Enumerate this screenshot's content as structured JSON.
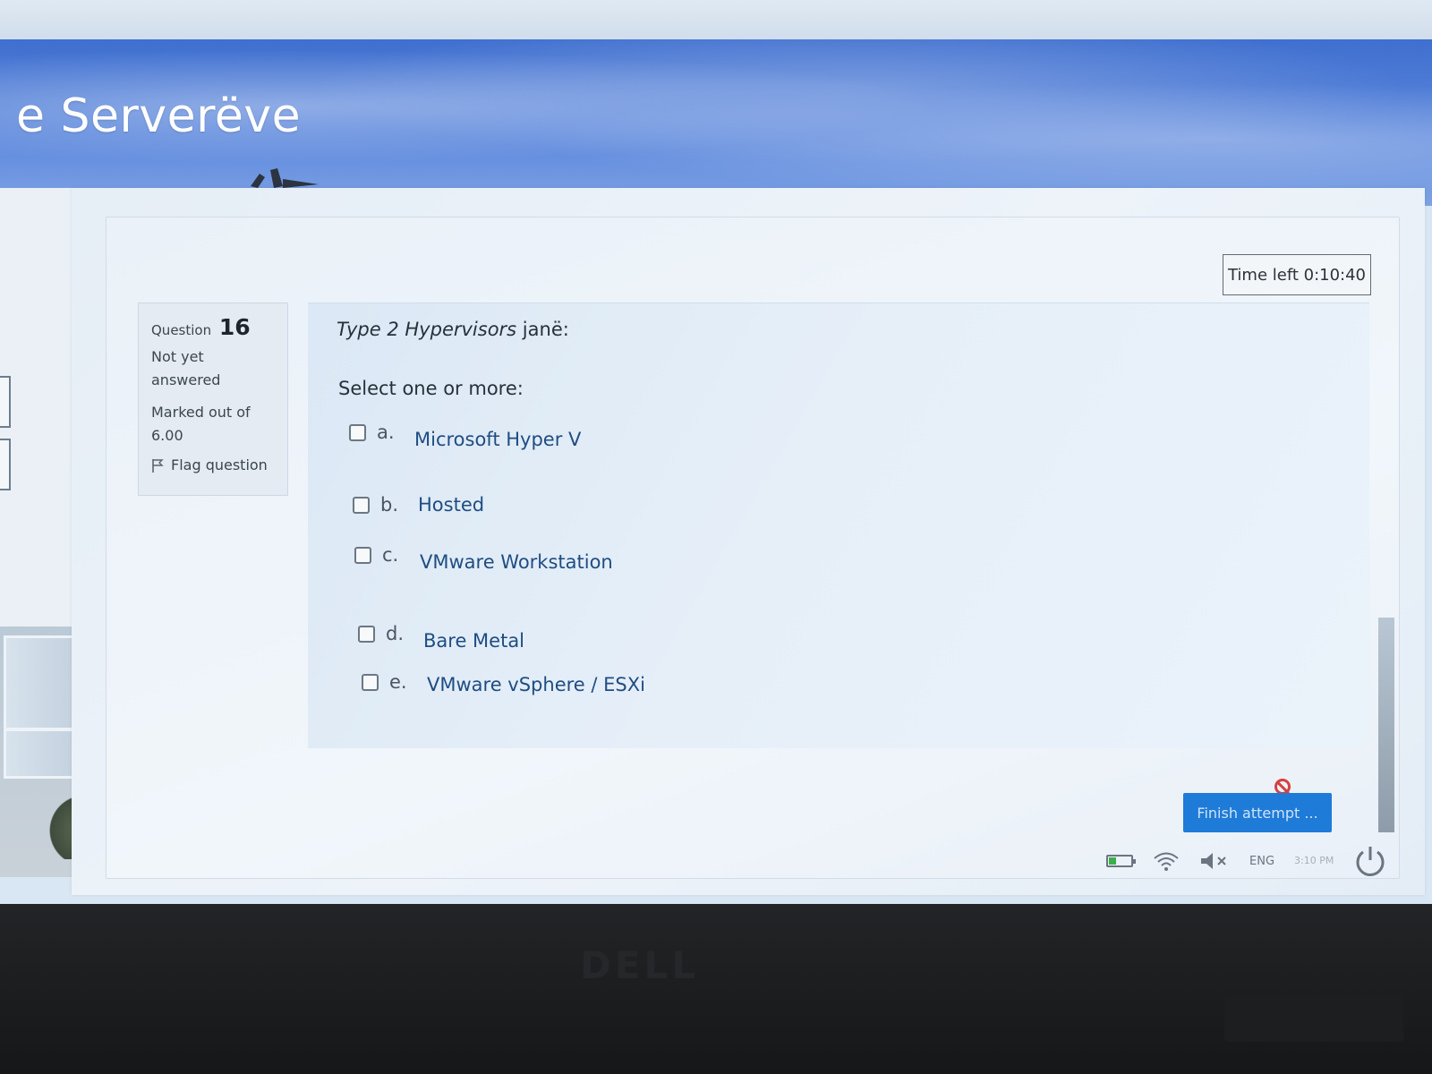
{
  "site": {
    "title": "e Serverëve"
  },
  "timer": {
    "label": "Time left 0:10:40"
  },
  "question_info": {
    "label": "Question",
    "number": "16",
    "state_line1": "Not yet",
    "state_line2": "answered",
    "marks_line1": "Marked out of",
    "marks_line2": "6.00",
    "flag_label": "Flag question"
  },
  "question": {
    "text_italic": "Type 2 Hypervisors",
    "text_rest": " janë:",
    "prompt": "Select one or more:",
    "options": [
      {
        "letter": "a.",
        "label": "Microsoft Hyper V",
        "checked": false
      },
      {
        "letter": "b.",
        "label": "Hosted",
        "checked": false
      },
      {
        "letter": "c.",
        "label": "VMware Workstation",
        "checked": false
      },
      {
        "letter": "d.",
        "label": "Bare Metal",
        "checked": false
      },
      {
        "letter": "e.",
        "label": "VMware vSphere / ESXi",
        "checked": false
      }
    ]
  },
  "actions": {
    "finish_label": "Finish attempt ..."
  },
  "tray": {
    "language": "ENG",
    "time": "3:10 PM"
  },
  "bezel": {
    "brand": "DELL"
  },
  "colors": {
    "accent": "#1e7bd8",
    "banner": "#4a78d6",
    "option_text": "#1f4d82"
  }
}
